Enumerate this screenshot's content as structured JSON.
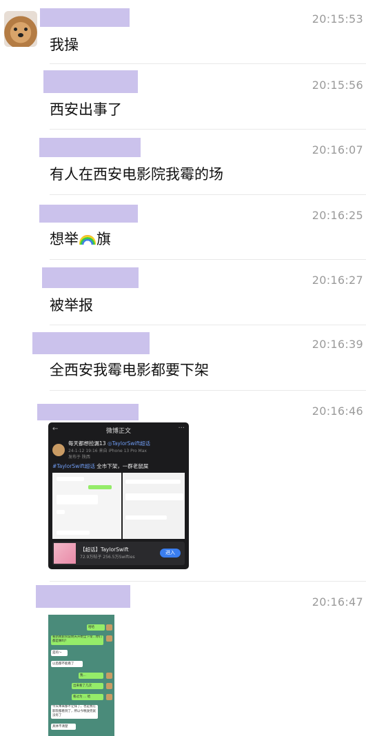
{
  "messages": [
    {
      "time": "20:15:53",
      "text": "我操"
    },
    {
      "time": "20:15:56",
      "text": "西安出事了"
    },
    {
      "time": "20:16:07",
      "text": "有人在西安电影院我霉的场"
    },
    {
      "time": "20:16:25",
      "text_before": "想举",
      "text_after": "旗",
      "emoji": "rainbow-flag"
    },
    {
      "time": "20:16:27",
      "text": "被举报"
    },
    {
      "time": "20:16:39",
      "text": "全西安我霉电影都要下架"
    },
    {
      "time": "20:16:46"
    },
    {
      "time": "20:16:47"
    }
  ],
  "weibo": {
    "title": "微博正文",
    "user": "每天都想捡漏13",
    "tag": "◎TaylorSwift超话",
    "meta": "24-1-12 19:16 来自 iPhone 13 Pro Max",
    "meta2": "发布于 陕西",
    "line_tag": "#TaylorSwift超话",
    "line_text": " 全市下架，一群老鼠屎",
    "card_title": "【超话】TaylorSwift",
    "card_sub": "72.9万帖子 256.5万Swifties",
    "card_btn": "进入"
  },
  "chatshot": {
    "lines": [
      "哈哈",
      "看新闻影院说明天开始全下架...你们都是嘛吗？",
      "是的～",
      "以后都不能看了",
      "我...",
      "出来看了几次",
      "看过为 ... 哈",
      "今天本来都不让排了，也是我在影院都看到了，所以今晚放完就没有了",
      "具体不清楚"
    ]
  }
}
